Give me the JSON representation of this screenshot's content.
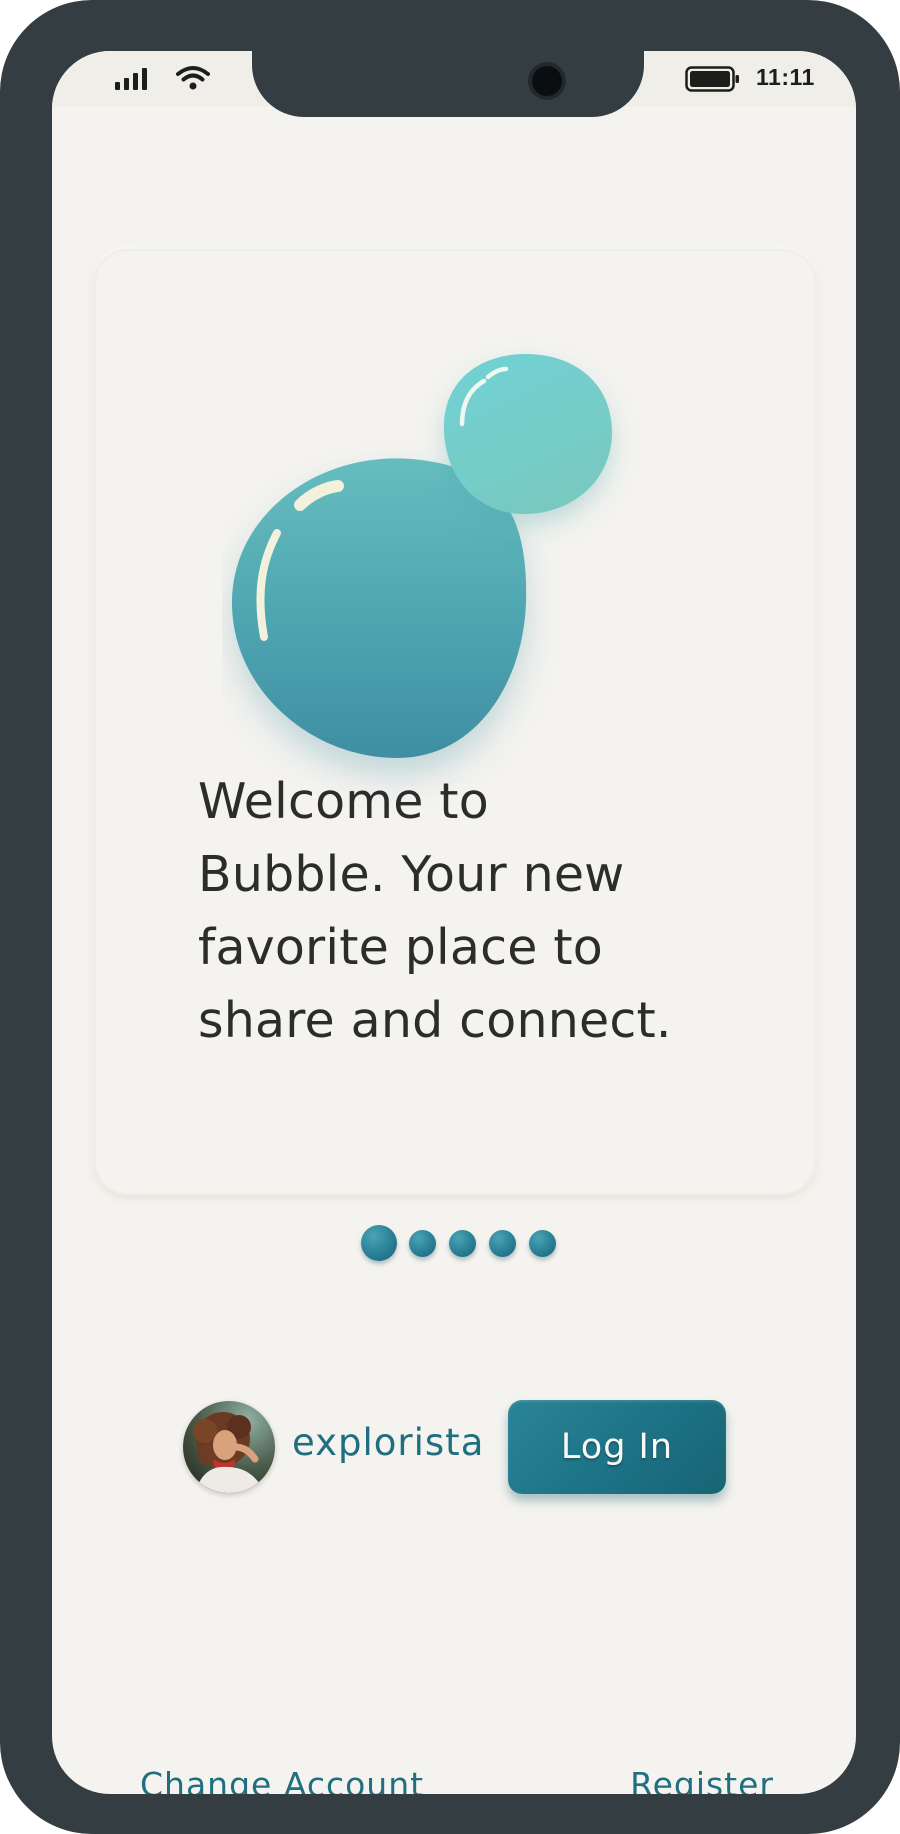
{
  "status_bar": {
    "time": "11:11",
    "icons": [
      "cellular-signal-icon",
      "wifi-icon",
      "battery-icon"
    ]
  },
  "onboarding": {
    "illustration": "bubble-illustration",
    "welcome_lines": [
      "Welcome to",
      "Bubble. Your new",
      "favorite place to",
      "share and connect."
    ],
    "pager": {
      "total_pages": 5,
      "current_page": 1
    }
  },
  "account": {
    "username": "explorista",
    "avatar": "user-avatar-photo",
    "login_label": "Log In"
  },
  "footer": {
    "change_account_label": "Change Account",
    "register_label": "Register"
  },
  "colors": {
    "frame": "#343d41",
    "background": "#f4f3ef",
    "accent": "#1f6f80",
    "button": "#1d7285",
    "text": "#2c2c2c"
  }
}
